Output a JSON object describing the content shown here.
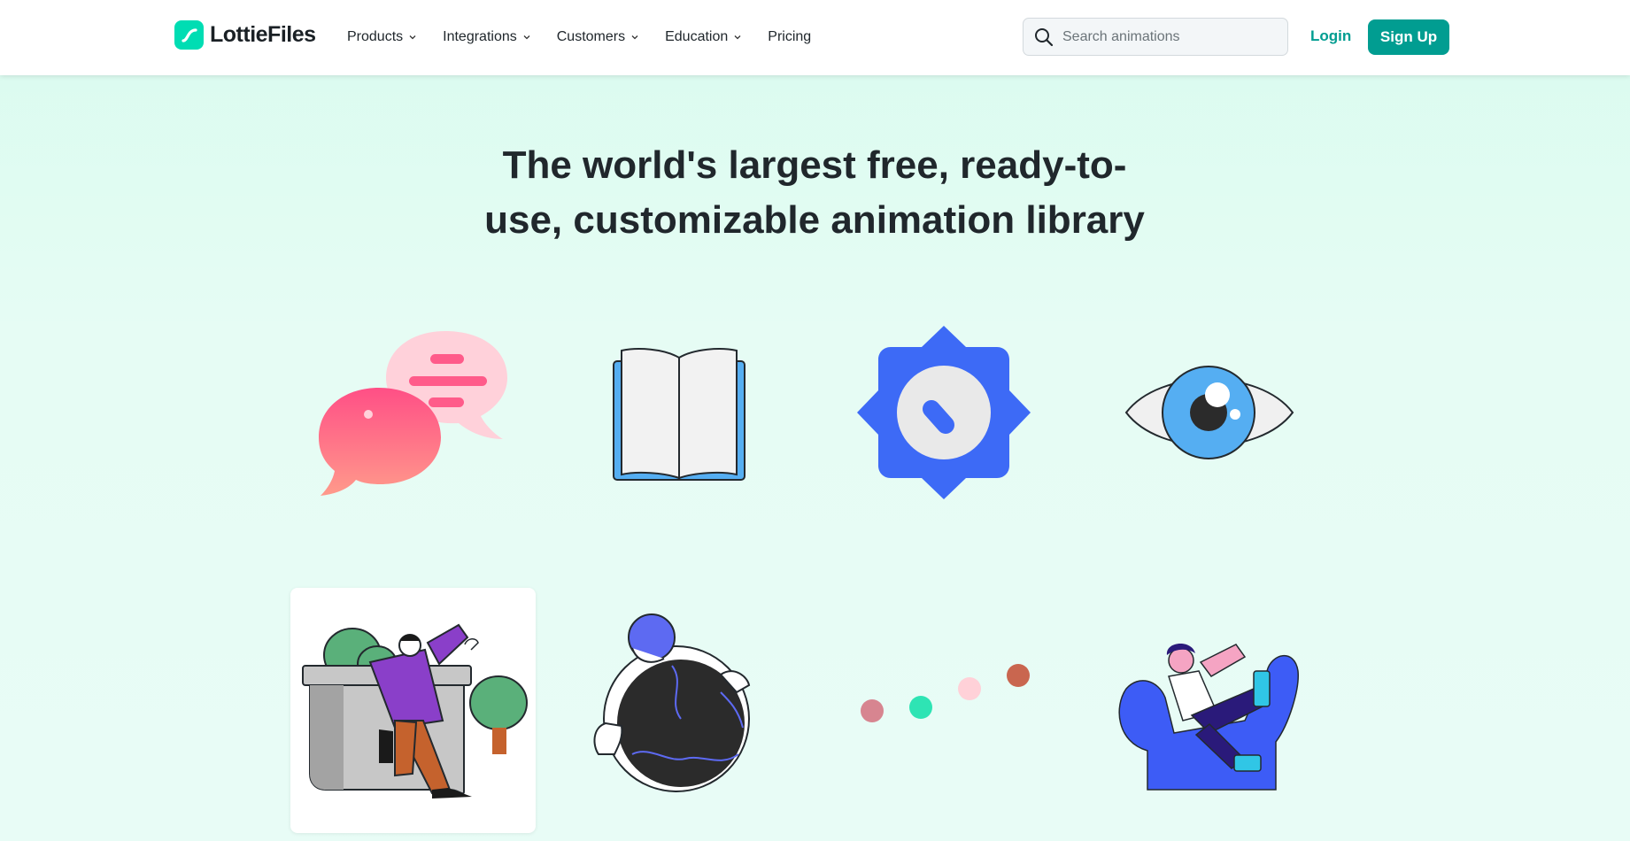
{
  "brand": {
    "name": "LottieFiles",
    "accent": "#019d91",
    "logo_color": "#00ddb3"
  },
  "nav": {
    "items": [
      {
        "label": "Products",
        "has_dropdown": true
      },
      {
        "label": "Integrations",
        "has_dropdown": true
      },
      {
        "label": "Customers",
        "has_dropdown": true
      },
      {
        "label": "Education",
        "has_dropdown": true
      },
      {
        "label": "Pricing",
        "has_dropdown": false
      }
    ]
  },
  "search": {
    "placeholder": "Search animations",
    "value": ""
  },
  "auth": {
    "login_label": "Login",
    "signup_label": "Sign Up"
  },
  "hero": {
    "title_line1": "The world's largest free, ready-to-",
    "title_line2": "use, customizable animation library"
  },
  "animations": [
    {
      "icon": "chat-bubbles-icon"
    },
    {
      "icon": "open-book-icon"
    },
    {
      "icon": "badge-clock-icon"
    },
    {
      "icon": "eye-icon"
    },
    {
      "icon": "person-leaning-wall-icon"
    },
    {
      "icon": "person-hugging-globe-icon"
    },
    {
      "icon": "loading-dots-icon"
    },
    {
      "icon": "person-sitting-chair-icon"
    }
  ]
}
